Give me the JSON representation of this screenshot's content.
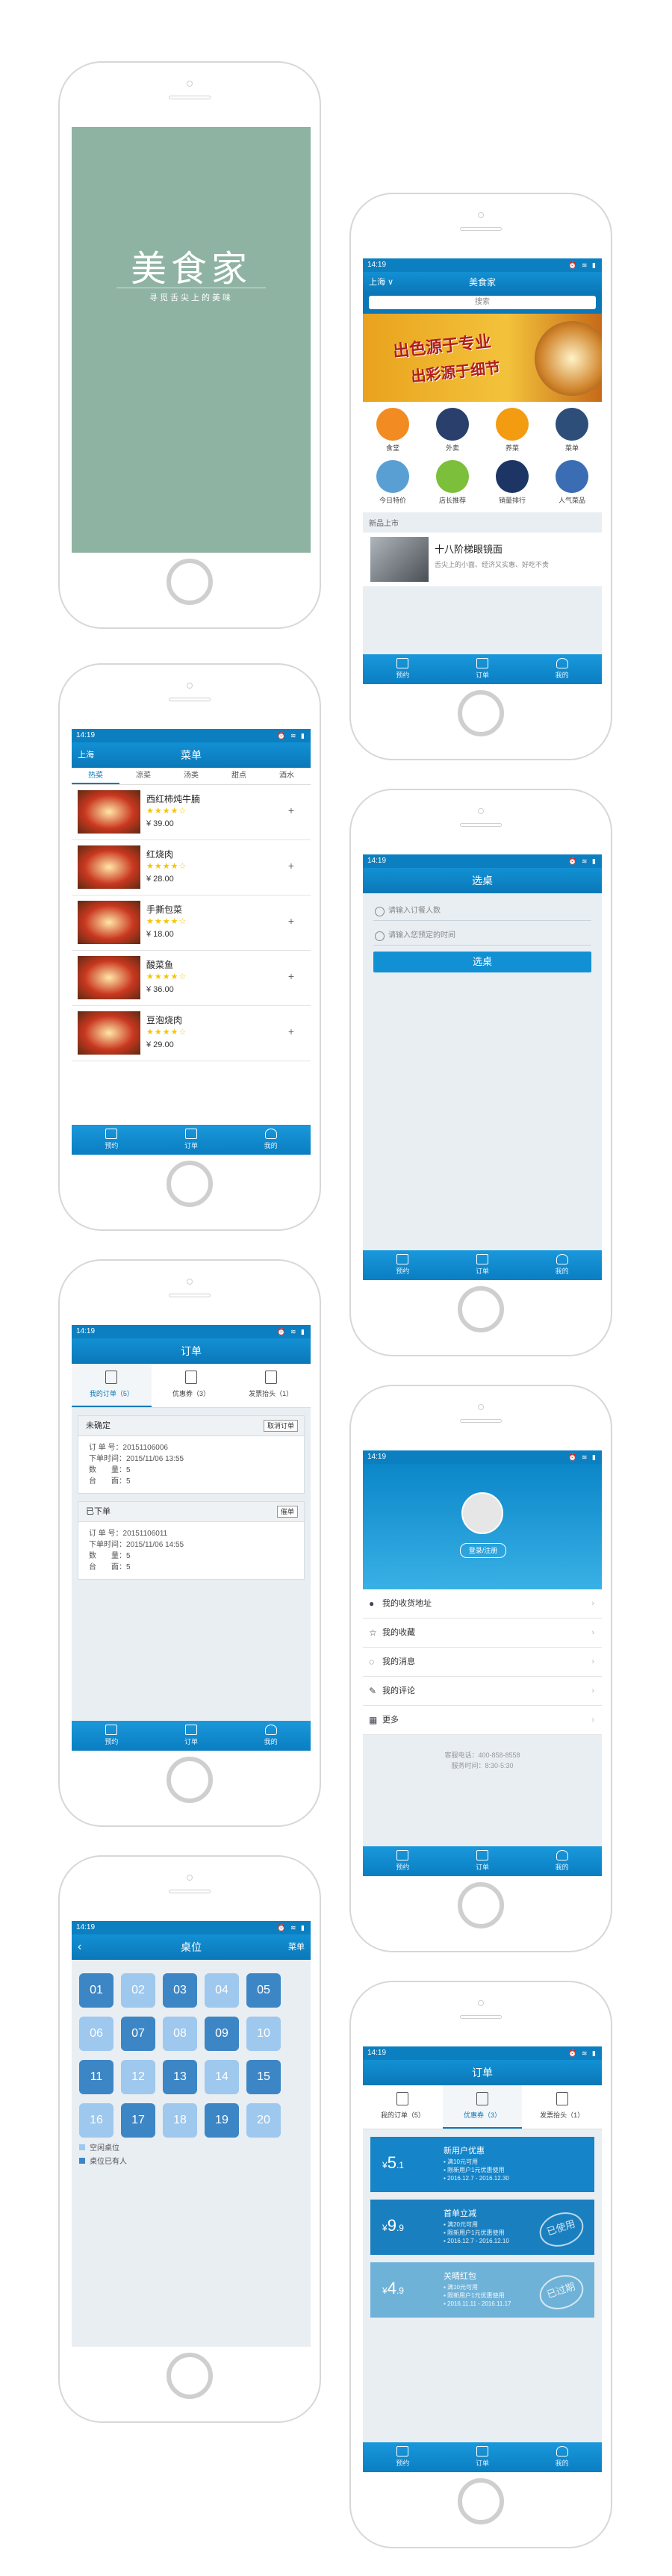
{
  "status": {
    "time": "14:19",
    "icons": "⏰ ≋ ▮"
  },
  "tabbar": {
    "tab1": "预约",
    "tab2": "订单",
    "tab3": "我的"
  },
  "splash": {
    "logo": "美食家",
    "slogan": "寻觅舌尖上的美味"
  },
  "home": {
    "city": "上海 ∨",
    "title": "美食家",
    "search": "搜索",
    "banner_line1": "出色源于专业",
    "banner_line2": "出彩源于细节",
    "grid": [
      {
        "label": "食堂",
        "color": "#f18b22"
      },
      {
        "label": "外卖",
        "color": "#2a3f6b"
      },
      {
        "label": "养菜",
        "color": "#f39c12"
      },
      {
        "label": "菜单",
        "color": "#2e4e7a"
      },
      {
        "label": "今日特价",
        "color": "#5a9fd4"
      },
      {
        "label": "店长推荐",
        "color": "#7cbf3a"
      },
      {
        "label": "销量排行",
        "color": "#1c3565"
      },
      {
        "label": "人气菜品",
        "color": "#3a6db3"
      }
    ],
    "new_title": "新品上市",
    "new_item_title": "十八阶梯眼镜面",
    "new_item_desc": "舌尖上的小面、经济又实惠、好吃不贵"
  },
  "menu": {
    "city": "上海",
    "title": "菜单",
    "cats": [
      "热菜",
      "凉菜",
      "汤类",
      "甜点",
      "酒水"
    ],
    "dishes": [
      {
        "name": "西红柿炖牛腩",
        "stars": "★★★★☆",
        "price": "¥ 39.00"
      },
      {
        "name": "红烧肉",
        "stars": "★★★★☆",
        "price": "¥ 28.00"
      },
      {
        "name": "手撕包菜",
        "stars": "★★★★☆",
        "price": "¥ 18.00"
      },
      {
        "name": "酸菜鱼",
        "stars": "★★★★☆",
        "price": "¥ 36.00"
      },
      {
        "name": "豆泡烧肉",
        "stars": "★★★★☆",
        "price": "¥ 29.00"
      }
    ]
  },
  "select": {
    "title": "选桌",
    "ph_count": "请输入订餐人数",
    "ph_time": "请输入您预定的时间",
    "btn": "选桌"
  },
  "orders": {
    "title": "订单",
    "tabs": [
      "我的订单（5）",
      "优惠券（3）",
      "发票抬头（1）"
    ],
    "cards": [
      {
        "status": "未确定",
        "btn": "取消订单",
        "no": "订 单 号：20151106006",
        "time": "下单时间：2015/11/06 13:55",
        "count": "数　　量：5",
        "table": "台　　面：5"
      },
      {
        "status": "已下单",
        "btn": "催单",
        "no": "订 单 号：20151106011",
        "time": "下单时间：2015/11/06 14:55",
        "count": "数　　量：5",
        "table": "台　　面：5"
      }
    ]
  },
  "profile": {
    "login": "登录/注册",
    "rows": [
      {
        "icon": "●",
        "label": "我的收货地址"
      },
      {
        "icon": "☆",
        "label": "我的收藏"
      },
      {
        "icon": "◌",
        "label": "我的消息"
      },
      {
        "icon": "✎",
        "label": "我的评论"
      },
      {
        "icon": "▦",
        "label": "更多"
      }
    ],
    "phone": "客服电话：400-858-8558",
    "hours": "服务时间：8:30-5:30"
  },
  "seats": {
    "back": "‹",
    "title": "桌位",
    "menu": "菜单",
    "list": [
      {
        "n": "01",
        "s": "taken"
      },
      {
        "n": "02",
        "s": "free"
      },
      {
        "n": "03",
        "s": "taken"
      },
      {
        "n": "04",
        "s": "free"
      },
      {
        "n": "05",
        "s": "taken"
      },
      {
        "n": "06",
        "s": "free"
      },
      {
        "n": "07",
        "s": "taken"
      },
      {
        "n": "08",
        "s": "free"
      },
      {
        "n": "09",
        "s": "taken"
      },
      {
        "n": "10",
        "s": "free"
      },
      {
        "n": "11",
        "s": "taken"
      },
      {
        "n": "12",
        "s": "free"
      },
      {
        "n": "13",
        "s": "taken"
      },
      {
        "n": "14",
        "s": "free"
      },
      {
        "n": "15",
        "s": "taken"
      },
      {
        "n": "16",
        "s": "free"
      },
      {
        "n": "17",
        "s": "taken"
      },
      {
        "n": "18",
        "s": "free"
      },
      {
        "n": "19",
        "s": "taken"
      },
      {
        "n": "20",
        "s": "free"
      }
    ],
    "legend_free": "空闲桌位",
    "legend_taken": "桌位已有人",
    "free_color": "#9ec8ee",
    "taken_color": "#3d86c6"
  },
  "coupons": {
    "title": "订单",
    "tabs": [
      "我的订单（5）",
      "优惠券（3）",
      "发票抬头（1）"
    ],
    "list": [
      {
        "amount": "5",
        "unit": ".1",
        "title": "新用户优惠",
        "line1": "▪ 满10元可用",
        "line2": "▪ 限新用户1元优惠使用",
        "line3": "▪ 2016.12.7 - 2016.12.30",
        "stamp": "",
        "color": "#1584c8"
      },
      {
        "amount": "9",
        "unit": ".9",
        "title": "首单立减",
        "line1": "▪ 满20元可用",
        "line2": "▪ 限新用户1元优惠使用",
        "line3": "▪ 2016.12.7 - 2016.12.10",
        "stamp": "已使用",
        "color": "#1a7fbf"
      },
      {
        "amount": "4",
        "unit": ".9",
        "title": "关晴红包",
        "line1": "▪ 满10元可用",
        "line2": "▪ 限新用户1元优惠使用",
        "line3": "▪ 2016.11.11 - 2016.11.17",
        "stamp": "已过期",
        "color": "#6fb2d8"
      }
    ]
  }
}
